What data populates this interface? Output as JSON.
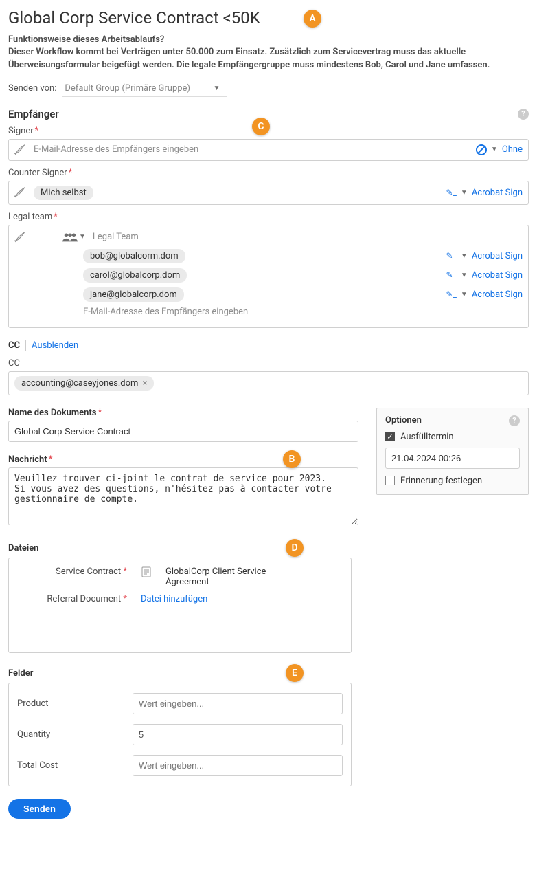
{
  "title": "Global Corp Service Contract <50K",
  "subheading": "Funktionsweise dieses Arbeitsablaufs?",
  "description": "Dieser Workflow kommt bei Verträgen unter 50.000 zum Einsatz. Zusätzlich zum Servicevertrag muss das aktuelle Überweisungsformular beigefügt werden. Die legale Empfängergruppe muss mindestens Bob, Carol und Jane umfassen.",
  "sendFrom": {
    "label": "Senden von:",
    "value": "Default Group (Primäre Gruppe)"
  },
  "recipients": {
    "heading": "Empfänger",
    "signer": {
      "label": "Signer",
      "placeholder": "E-Mail-Adresse des Empfängers eingeben",
      "authLabel": "Ohne"
    },
    "counterSigner": {
      "label": "Counter Signer",
      "chip": "Mich selbst",
      "authLabel": "Acrobat Sign"
    },
    "legalTeam": {
      "label": "Legal team",
      "teamName": "Legal Team",
      "members": [
        {
          "email": "bob@globalcorm.dom",
          "auth": "Acrobat Sign"
        },
        {
          "email": "carol@globalcorp.dom",
          "auth": "Acrobat Sign"
        },
        {
          "email": "jane@globalcorp.dom",
          "auth": "Acrobat Sign"
        }
      ],
      "addPlaceholder": "E-Mail-Adresse des Empfängers eingeben"
    }
  },
  "cc": {
    "headLabel": "CC",
    "hideLabel": "Ausblenden",
    "label": "CC",
    "chip": "accounting@caseyjones.dom"
  },
  "docName": {
    "label": "Name des Dokuments",
    "value": "Global Corp Service Contract"
  },
  "message": {
    "label": "Nachricht",
    "value": "Veuillez trouver ci-joint le contrat de service pour 2023.\nSi vous avez des questions, n'hésitez pas à contacter votre gestionnaire de compte."
  },
  "options": {
    "heading": "Optionen",
    "deadlineLabel": "Ausfülltermin",
    "deadlineValue": "21.04.2024 00:26",
    "reminderLabel": "Erinnerung festlegen"
  },
  "files": {
    "heading": "Dateien",
    "rows": [
      {
        "label": "Service Contract",
        "required": true,
        "name": "GlobalCorp Client Service Agreement"
      },
      {
        "label": "Referral Document",
        "required": true,
        "add": "Datei hinzufügen"
      }
    ]
  },
  "fields": {
    "heading": "Felder",
    "rows": [
      {
        "label": "Product",
        "value": "",
        "placeholder": "Wert eingeben..."
      },
      {
        "label": "Quantity",
        "value": "5",
        "placeholder": ""
      },
      {
        "label": "Total Cost",
        "value": "",
        "placeholder": "Wert eingeben..."
      }
    ]
  },
  "sendButton": "Senden",
  "callouts": {
    "a": "A",
    "b": "B",
    "c": "C",
    "d": "D",
    "e": "E"
  }
}
